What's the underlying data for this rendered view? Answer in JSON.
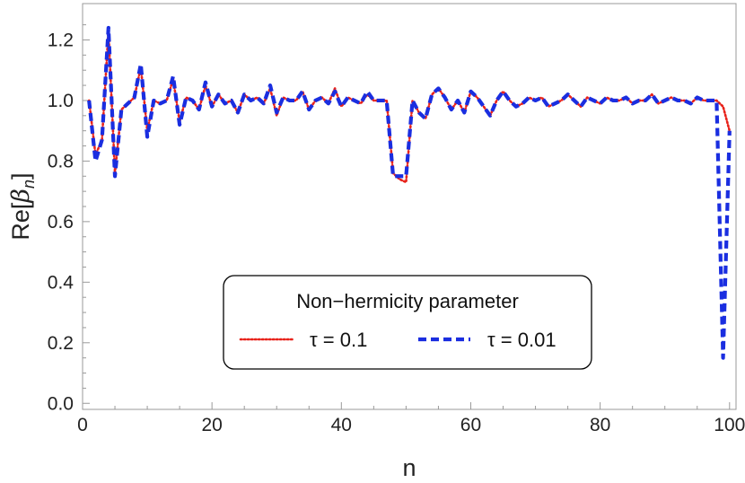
{
  "chart_data": {
    "type": "line",
    "title": "",
    "xlabel": "n",
    "ylabel_prefix": "Re[",
    "ylabel_symbol": "β",
    "ylabel_subscript": "n",
    "ylabel_suffix": "]",
    "xlim": [
      0,
      101
    ],
    "ylim": [
      -0.02,
      1.32
    ],
    "xticks": [
      0,
      20,
      40,
      60,
      80,
      100
    ],
    "yticks": [
      0.0,
      0.2,
      0.4,
      0.6,
      0.8,
      1.0,
      1.2
    ],
    "xtick_labels": [
      "0",
      "20",
      "40",
      "60",
      "80",
      "100"
    ],
    "ytick_labels": [
      "0.0",
      "0.2",
      "0.4",
      "0.6",
      "0.8",
      "1.0",
      "1.2"
    ],
    "grid": false,
    "legend": {
      "position": "bottom-center",
      "title": "Non−hermicity parameter"
    },
    "x": [
      1,
      2,
      3,
      4,
      5,
      6,
      7,
      8,
      9,
      10,
      11,
      12,
      13,
      14,
      15,
      16,
      17,
      18,
      19,
      20,
      21,
      22,
      23,
      24,
      25,
      26,
      27,
      28,
      29,
      30,
      31,
      32,
      33,
      34,
      35,
      36,
      37,
      38,
      39,
      40,
      41,
      42,
      43,
      44,
      45,
      46,
      47,
      48,
      49,
      50,
      51,
      52,
      53,
      54,
      55,
      56,
      57,
      58,
      59,
      60,
      61,
      62,
      63,
      64,
      65,
      66,
      67,
      68,
      69,
      70,
      71,
      72,
      73,
      74,
      75,
      76,
      77,
      78,
      79,
      80,
      81,
      82,
      83,
      84,
      85,
      86,
      87,
      88,
      89,
      90,
      91,
      92,
      93,
      94,
      95,
      96,
      97,
      98,
      99,
      100
    ],
    "series": [
      {
        "name": "τ = 0.1",
        "color": "#e8231b",
        "style": "dotted",
        "values": [
          1.0,
          0.82,
          0.87,
          1.23,
          0.76,
          0.97,
          0.99,
          1.01,
          1.11,
          0.9,
          1.0,
          0.99,
          1.0,
          1.07,
          0.93,
          1.01,
          1.0,
          0.97,
          1.05,
          0.98,
          1.02,
          0.99,
          1.0,
          0.96,
          1.02,
          1.0,
          1.01,
          0.99,
          1.04,
          0.95,
          1.01,
          1.0,
          1.0,
          1.03,
          0.97,
          1.0,
          1.01,
          0.99,
          1.04,
          0.98,
          1.01,
          1.0,
          0.99,
          1.02,
          1.0,
          1.0,
          1.0,
          0.76,
          0.74,
          0.73,
          1.0,
          0.96,
          0.94,
          1.02,
          1.04,
          1.01,
          0.97,
          1.0,
          0.96,
          1.03,
          1.01,
          0.98,
          0.95,
          1.0,
          1.03,
          1.0,
          0.98,
          0.99,
          1.01,
          1.0,
          1.01,
          0.98,
          0.99,
          1.0,
          1.02,
          1.0,
          0.98,
          1.01,
          1.0,
          0.99,
          1.01,
          1.0,
          1.0,
          1.01,
          0.99,
          1.0,
          1.0,
          1.02,
          0.99,
          1.0,
          1.01,
          1.0,
          1.0,
          0.99,
          1.01,
          1.0,
          1.0,
          1.0,
          0.98,
          0.9
        ]
      },
      {
        "name": "τ = 0.01",
        "color": "#1a2ee0",
        "style": "dashed",
        "values": [
          1.0,
          0.8,
          0.87,
          1.24,
          0.75,
          0.97,
          0.99,
          1.01,
          1.12,
          0.88,
          1.0,
          0.99,
          1.0,
          1.08,
          0.92,
          1.01,
          1.0,
          0.97,
          1.06,
          0.98,
          1.02,
          0.99,
          1.0,
          0.96,
          1.02,
          1.0,
          1.01,
          0.99,
          1.05,
          0.96,
          1.01,
          1.0,
          1.0,
          1.03,
          0.97,
          1.0,
          1.01,
          0.99,
          1.03,
          0.98,
          1.01,
          1.0,
          0.99,
          1.03,
          1.0,
          1.0,
          1.0,
          0.75,
          0.75,
          0.75,
          1.0,
          0.96,
          0.94,
          1.02,
          1.04,
          1.01,
          0.97,
          1.0,
          0.96,
          1.03,
          1.01,
          0.98,
          0.95,
          1.0,
          1.03,
          1.0,
          0.98,
          0.99,
          1.01,
          1.0,
          1.01,
          0.98,
          0.99,
          1.0,
          1.02,
          1.0,
          0.98,
          1.01,
          1.0,
          0.99,
          1.01,
          1.0,
          1.0,
          1.01,
          0.99,
          1.0,
          1.0,
          1.02,
          0.99,
          1.0,
          1.01,
          1.0,
          1.0,
          0.99,
          1.01,
          1.0,
          1.0,
          1.0,
          0.15,
          0.9
        ]
      }
    ]
  }
}
